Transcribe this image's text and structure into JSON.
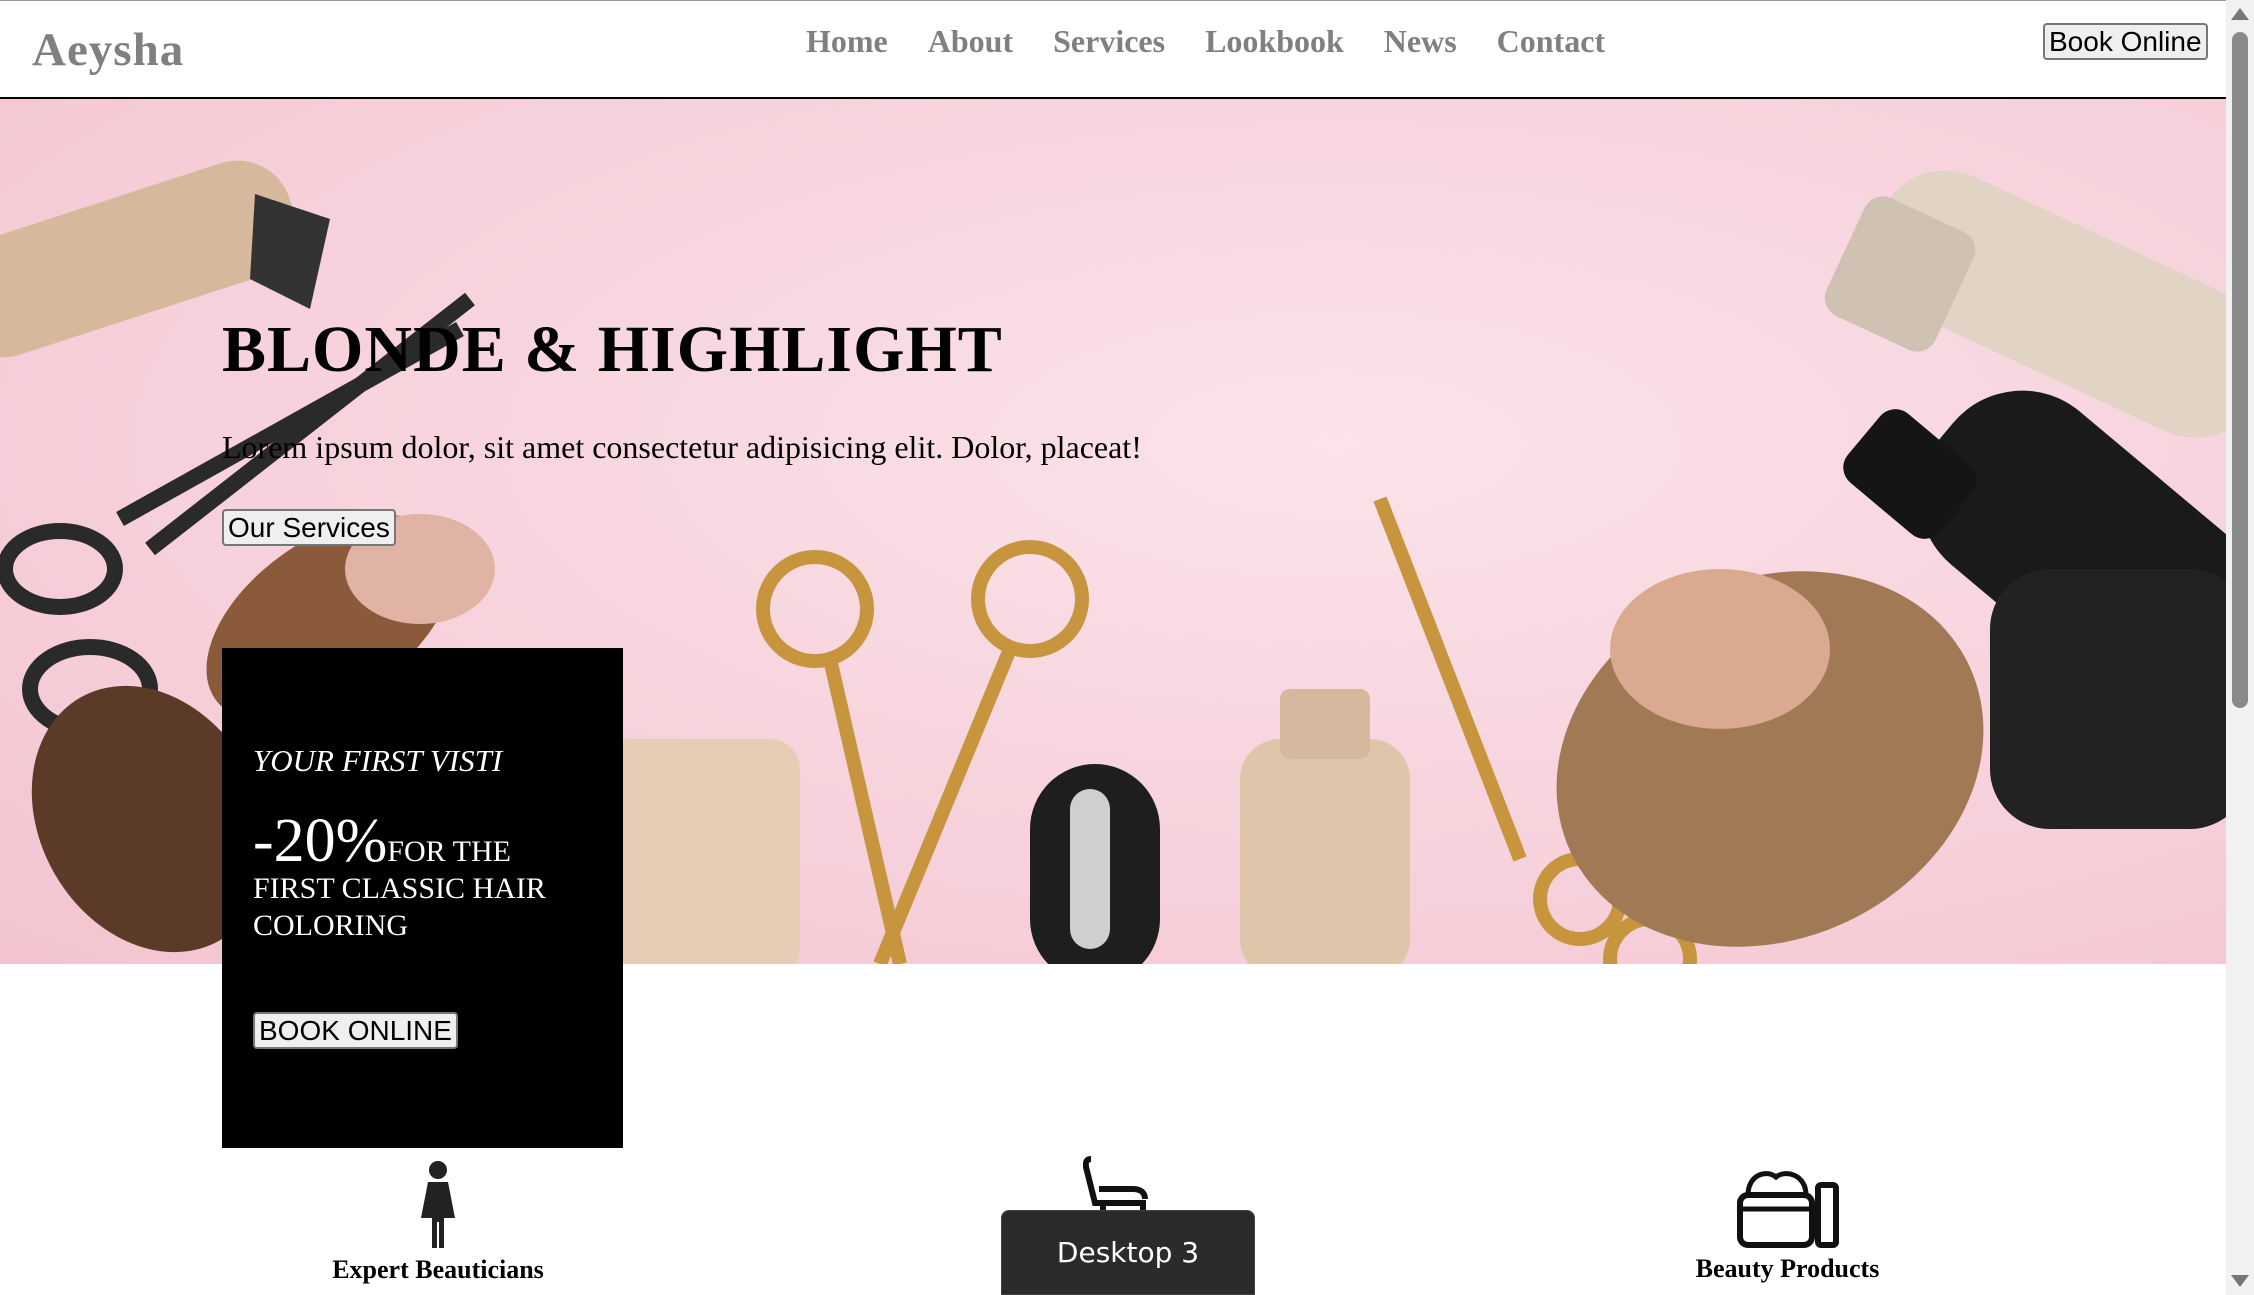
{
  "header": {
    "logo": "Aeysha",
    "nav": [
      "Home",
      "About",
      "Services",
      "Lookbook",
      "News",
      "Contact"
    ],
    "book_label": "Book Online"
  },
  "hero": {
    "title": "BLONDE & HIGHLIGHT",
    "subtitle": "Lorem ipsum dolor, sit amet consectetur adipisicing elit. Dolor, placeat!",
    "button": "Our Services",
    "background": "#f7d2dc"
  },
  "promo": {
    "kicker": "YOUR FIRST VISTI",
    "discount": "-20%",
    "offer": "FOR THE FIRST CLASSIC HAIR COLORING",
    "button": "BOOK ONLINE"
  },
  "features": [
    {
      "label": "Expert Beauticians",
      "icon": "woman-icon"
    },
    {
      "label": "",
      "icon": "salon-chair-icon"
    },
    {
      "label": "Beauty Products",
      "icon": "cosmetics-icon"
    }
  ],
  "taskbar": {
    "tooltip": "Desktop 3"
  }
}
